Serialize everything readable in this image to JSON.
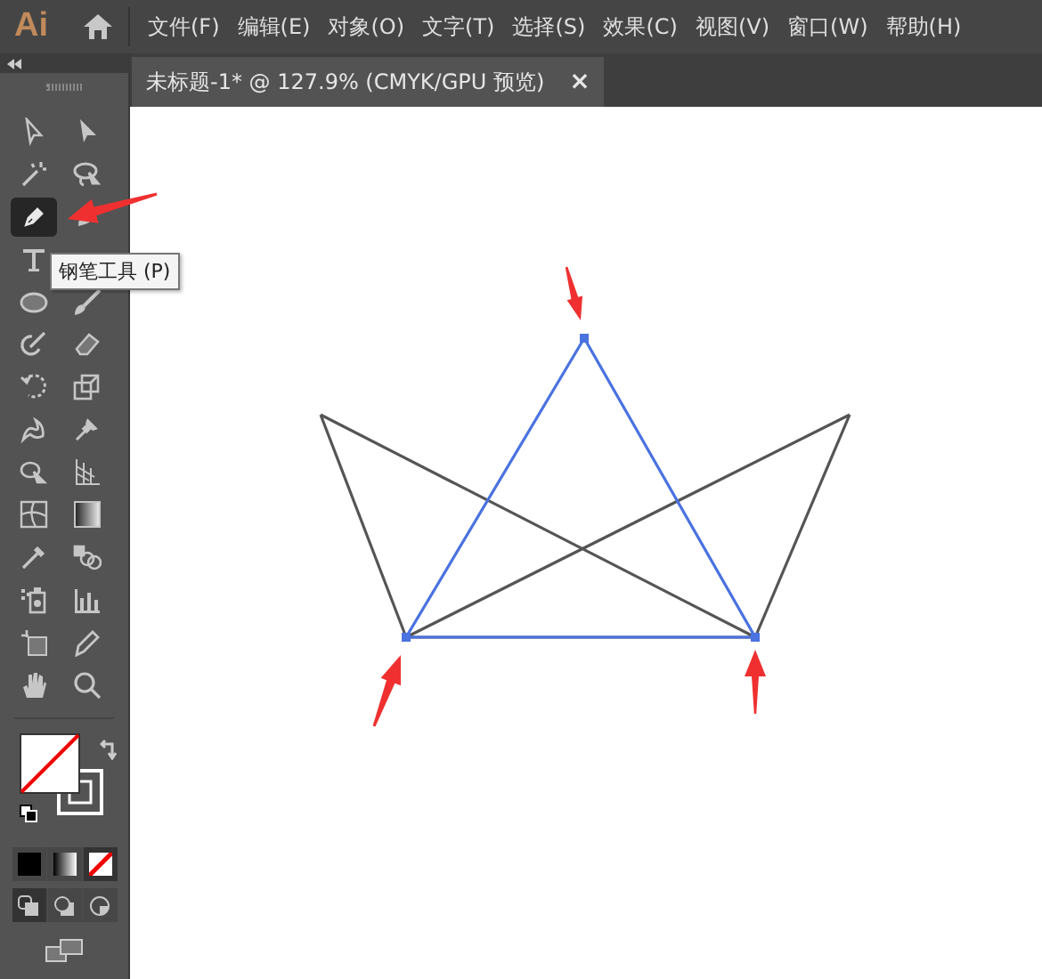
{
  "app": {
    "logo": "Ai"
  },
  "menu": [
    "文件(F)",
    "编辑(E)",
    "对象(O)",
    "文字(T)",
    "选择(S)",
    "效果(C)",
    "视图(V)",
    "窗口(W)",
    "帮助(H)"
  ],
  "document_tab": {
    "title": "未标题-1* @ 127.9% (CMYK/GPU 预览)",
    "close": "×",
    "selected": true
  },
  "tool_rows": [
    [
      {
        "kind": "select",
        "selected": false
      },
      {
        "kind": "direct",
        "selected": false
      }
    ],
    [
      {
        "kind": "wand",
        "selected": false
      },
      {
        "kind": "lasso",
        "selected": false
      }
    ],
    [
      {
        "kind": "pen",
        "selected": true
      },
      {
        "kind": "curvature",
        "selected": false
      }
    ],
    [
      {
        "kind": "type",
        "selected": false
      }
    ],
    [
      {
        "kind": "ellipse",
        "selected": false
      },
      {
        "kind": "brush",
        "selected": false
      }
    ],
    [
      {
        "kind": "shaper",
        "selected": false
      },
      {
        "kind": "eraser",
        "selected": false
      }
    ],
    [
      {
        "kind": "rotate",
        "selected": false
      },
      {
        "kind": "scale",
        "selected": false
      }
    ],
    [
      {
        "kind": "warp",
        "selected": false
      },
      {
        "kind": "pin",
        "selected": false
      }
    ],
    [
      {
        "kind": "builder",
        "selected": false
      },
      {
        "kind": "perspective",
        "selected": false
      }
    ],
    [
      {
        "kind": "mesh",
        "selected": false
      },
      {
        "kind": "gradient",
        "selected": false
      }
    ],
    [
      {
        "kind": "eyedropper",
        "selected": false
      },
      {
        "kind": "blend",
        "selected": false
      }
    ],
    [
      {
        "kind": "sprayer",
        "selected": false
      },
      {
        "kind": "graph",
        "selected": false
      }
    ],
    [
      {
        "kind": "artboard",
        "selected": false
      },
      {
        "kind": "knife",
        "selected": false
      }
    ],
    [
      {
        "kind": "hand",
        "selected": false
      },
      {
        "kind": "zoom",
        "selected": false
      }
    ]
  ],
  "color_modes": [
    {
      "kind": "color",
      "selected": false
    },
    {
      "kind": "gradient",
      "selected": false
    },
    {
      "kind": "none",
      "selected": true
    }
  ],
  "draw_modes": [
    {
      "kind": "normal",
      "selected": true
    },
    {
      "kind": "behind",
      "selected": false
    },
    {
      "kind": "inside",
      "selected": false
    }
  ],
  "tooltip": "钢笔工具 (P)"
}
